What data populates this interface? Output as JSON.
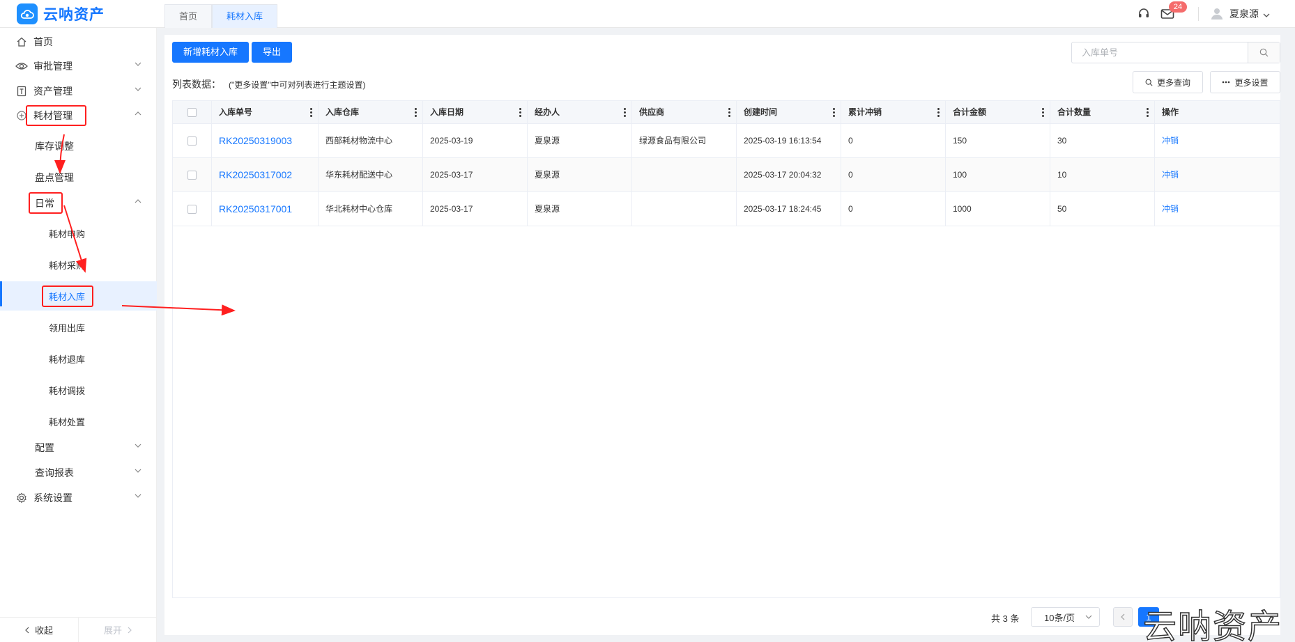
{
  "app": {
    "logo_text": "云呐资产"
  },
  "tabs": [
    {
      "label": "首页",
      "active": false
    },
    {
      "label": "耗材入库",
      "active": true
    }
  ],
  "header": {
    "mail_badge": "24",
    "user_name": "夏泉源"
  },
  "sidebar": {
    "items": [
      {
        "label": "首页",
        "icon": "home-icon"
      },
      {
        "label": "审批管理",
        "icon": "eye-icon"
      },
      {
        "label": "资产管理",
        "icon": "asset-icon"
      },
      {
        "label": "耗材管理",
        "icon": "consumable-icon"
      },
      {
        "label": "库存调整"
      },
      {
        "label": "盘点管理"
      },
      {
        "label": "日常"
      },
      {
        "label": "耗材申购"
      },
      {
        "label": "耗材采购"
      },
      {
        "label": "耗材入库"
      },
      {
        "label": "领用出库"
      },
      {
        "label": "耗材退库"
      },
      {
        "label": "耗材调拨"
      },
      {
        "label": "耗材处置"
      },
      {
        "label": "配置"
      },
      {
        "label": "查询报表"
      },
      {
        "label": "系统设置",
        "icon": "gear-icon"
      }
    ],
    "collapse_label": "收起",
    "expand_label": "展开"
  },
  "toolbar": {
    "add_label": "新增耗材入库",
    "export_label": "导出",
    "search_placeholder": "入库单号",
    "list_title": "列表数据：",
    "list_hint": "(\"更多设置\"中可对列表进行主题设置)",
    "more_query_label": "更多查询",
    "more_settings_label": "更多设置"
  },
  "table": {
    "columns": [
      "入库单号",
      "入库仓库",
      "入库日期",
      "经办人",
      "供应商",
      "创建时间",
      "累计冲销",
      "合计金额",
      "合计数量",
      "操作"
    ],
    "rows": [
      [
        "RK20250319003",
        "西部耗材物流中心",
        "2025-03-19",
        "夏泉源",
        "绿源食品有限公司",
        "2025-03-19 16:13:54",
        "0",
        "150",
        "30",
        "冲销"
      ],
      [
        "RK20250317002",
        "华东耗材配送中心",
        "2025-03-17",
        "夏泉源",
        "",
        "2025-03-17 20:04:32",
        "0",
        "100",
        "10",
        "冲销"
      ],
      [
        "RK20250317001",
        "华北耗材中心仓库",
        "2025-03-17",
        "夏泉源",
        "",
        "2025-03-17 18:24:45",
        "0",
        "1000",
        "50",
        "冲销"
      ]
    ]
  },
  "pagination": {
    "total_label": "共 3 条",
    "page_size_label": "10条/页",
    "current_page": "1"
  },
  "watermark": "云呐资产",
  "colors": {
    "primary": "#1677ff",
    "annotation": "#ff1f1f",
    "badge": "#f56c6c"
  }
}
